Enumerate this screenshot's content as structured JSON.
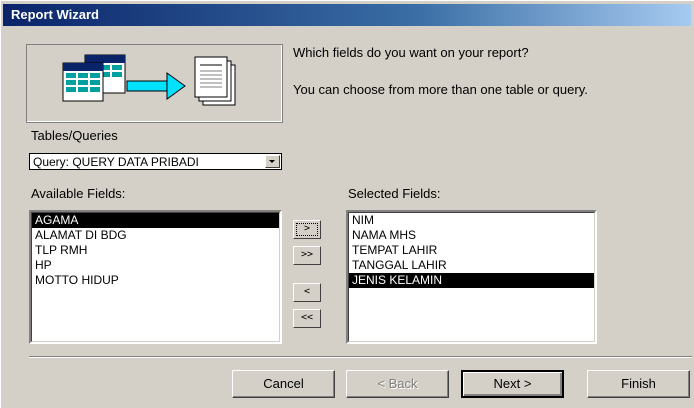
{
  "window": {
    "title": "Report Wizard"
  },
  "prompt": {
    "line1": "Which fields do you want on your report?",
    "line2": "You can choose from more than one table or query."
  },
  "tables_queries": {
    "label": "Tables/Queries",
    "selected": "Query: QUERY DATA PRIBADI"
  },
  "available": {
    "label": "Available Fields:",
    "items": [
      "AGAMA",
      "ALAMAT DI BDG",
      "TLP RMH",
      "HP",
      "MOTTO HIDUP"
    ],
    "selected_index": 0
  },
  "selected_fields": {
    "label": "Selected Fields:",
    "items": [
      "NIM",
      "NAMA MHS",
      "TEMPAT LAHIR",
      "TANGGAL LAHIR",
      "JENIS KELAMIN"
    ],
    "selected_index": 4
  },
  "move_buttons": {
    "add_one": ">",
    "add_all": ">>",
    "remove_one": "<",
    "remove_all": "<<"
  },
  "buttons": {
    "cancel": "Cancel",
    "back": "< Back",
    "next": "Next >",
    "finish": "Finish"
  },
  "icons": {
    "wizard_graphic": "tables-to-report-graphic",
    "combo_arrow": "chevron-down-icon"
  }
}
